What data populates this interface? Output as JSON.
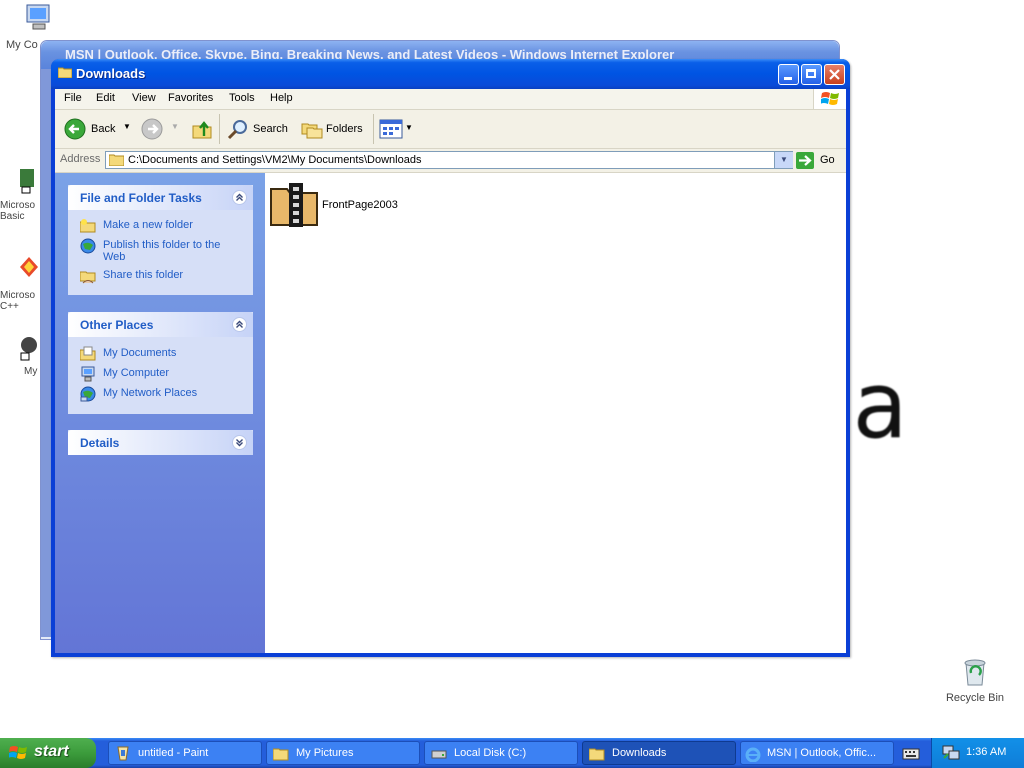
{
  "desktop": {
    "icons": [
      {
        "label": "My Co"
      },
      {
        "label": "Microso Basic"
      },
      {
        "label": "Microso C++"
      },
      {
        "label": "My"
      },
      {
        "label": "Recycle Bin"
      }
    ],
    "background_glyph": "a"
  },
  "ie_window": {
    "title": "MSN | Outlook, Office, Skype, Bing, Breaking News, and Latest Videos - Windows Internet Explorer"
  },
  "window": {
    "title": "Downloads",
    "menu": [
      "File",
      "Edit",
      "View",
      "Favorites",
      "Tools",
      "Help"
    ],
    "toolbar": {
      "back": "Back",
      "search": "Search",
      "folders": "Folders"
    },
    "address": {
      "label": "Address",
      "path": "C:\\Documents and Settings\\VM2\\My Documents\\Downloads",
      "go": "Go"
    },
    "tasks_panel": {
      "title": "File and Folder Tasks",
      "items": [
        {
          "label": "Make a new folder",
          "icon": "new-folder-icon"
        },
        {
          "label": "Publish this folder to the Web",
          "icon": "publish-web-icon"
        },
        {
          "label": "Share this folder",
          "icon": "share-folder-icon"
        }
      ]
    },
    "places_panel": {
      "title": "Other Places",
      "items": [
        {
          "label": "My Documents",
          "icon": "my-documents-icon"
        },
        {
          "label": "My Computer",
          "icon": "my-computer-icon"
        },
        {
          "label": "My Network Places",
          "icon": "network-places-icon"
        }
      ]
    },
    "details_panel": {
      "title": "Details"
    },
    "files": [
      {
        "name": "FrontPage2003",
        "icon": "zip-folder-icon"
      }
    ]
  },
  "taskbar": {
    "start": "start",
    "tasks": [
      {
        "label": "untitled - Paint",
        "active": false
      },
      {
        "label": "My Pictures",
        "active": false
      },
      {
        "label": "Local Disk (C:)",
        "active": false
      },
      {
        "label": "Downloads",
        "active": true
      },
      {
        "label": "MSN | Outlook, Offic...",
        "active": false
      }
    ],
    "clock": "1:36 AM"
  },
  "colors": {
    "titlebar": "#0054e3",
    "taskpane": "#7ba2e7",
    "panel_text": "#215dc6",
    "taskbar": "#245edb",
    "start": "#3c9c3c"
  }
}
